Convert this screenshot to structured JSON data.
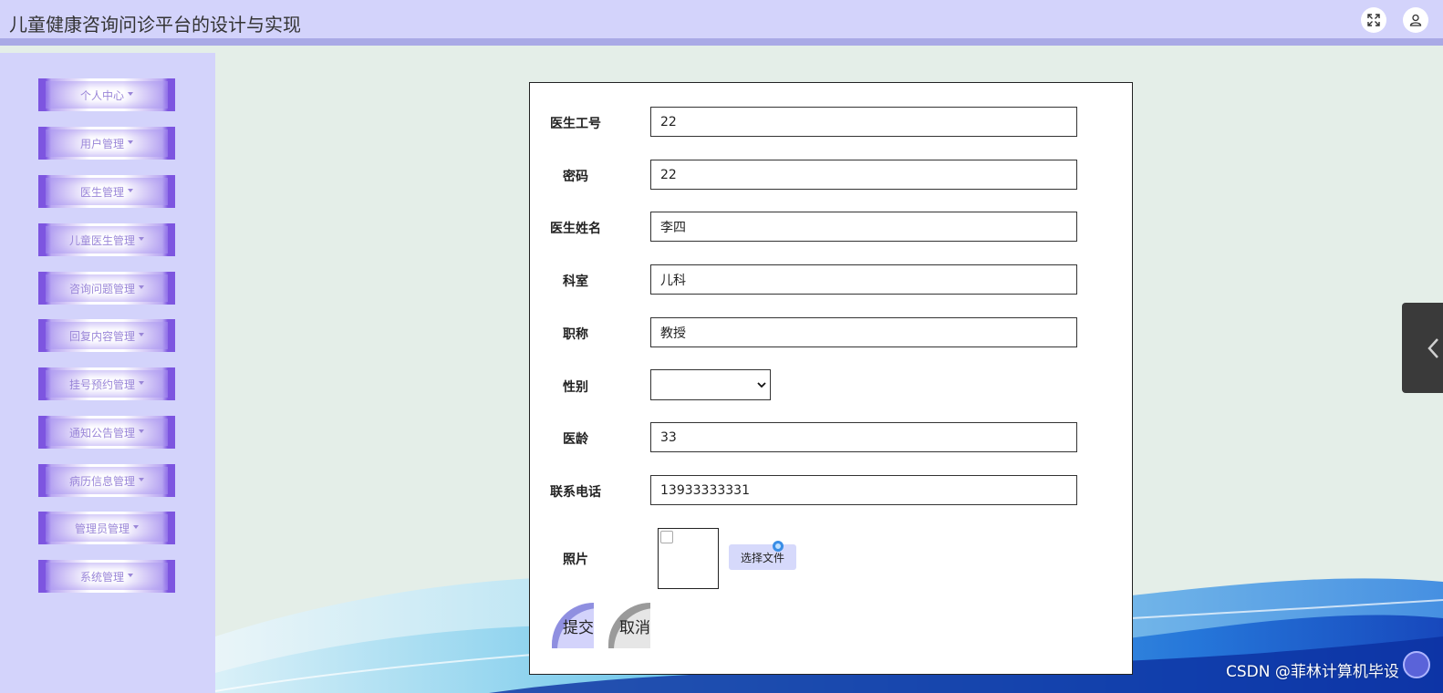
{
  "header": {
    "title": "儿童健康咨询问诊平台的设计与实现",
    "fullscreen_icon": "expand-icon",
    "user_icon": "user-icon"
  },
  "sidebar": {
    "items": [
      {
        "label": "个人中心"
      },
      {
        "label": "用户管理"
      },
      {
        "label": "医生管理"
      },
      {
        "label": "儿童医生管理"
      },
      {
        "label": "咨询问题管理"
      },
      {
        "label": "回复内容管理"
      },
      {
        "label": "挂号预约管理"
      },
      {
        "label": "通知公告管理"
      },
      {
        "label": "病历信息管理"
      },
      {
        "label": "管理员管理"
      },
      {
        "label": "系统管理"
      }
    ]
  },
  "form": {
    "doctor_id": {
      "label": "医生工号",
      "value": "22"
    },
    "password": {
      "label": "密码",
      "value": "22"
    },
    "doctor_name": {
      "label": "医生姓名",
      "value": "李四"
    },
    "department": {
      "label": "科室",
      "value": "儿科"
    },
    "title": {
      "label": "职称",
      "value": "教授"
    },
    "gender": {
      "label": "性别",
      "value": ""
    },
    "years": {
      "label": "医龄",
      "value": "33"
    },
    "phone": {
      "label": "联系电话",
      "value": "13933333331"
    },
    "photo": {
      "label": "照片",
      "button_label": "选择文件"
    },
    "submit_label": "提交",
    "cancel_label": "取消"
  },
  "watermark": "CSDN @菲林计算机毕设",
  "colors": {
    "header_bg": "#d3d3fb",
    "sidebar_bg": "#d3d3fb",
    "menu_accent": "#7d55e0",
    "main_bg": "#e4eee8"
  }
}
